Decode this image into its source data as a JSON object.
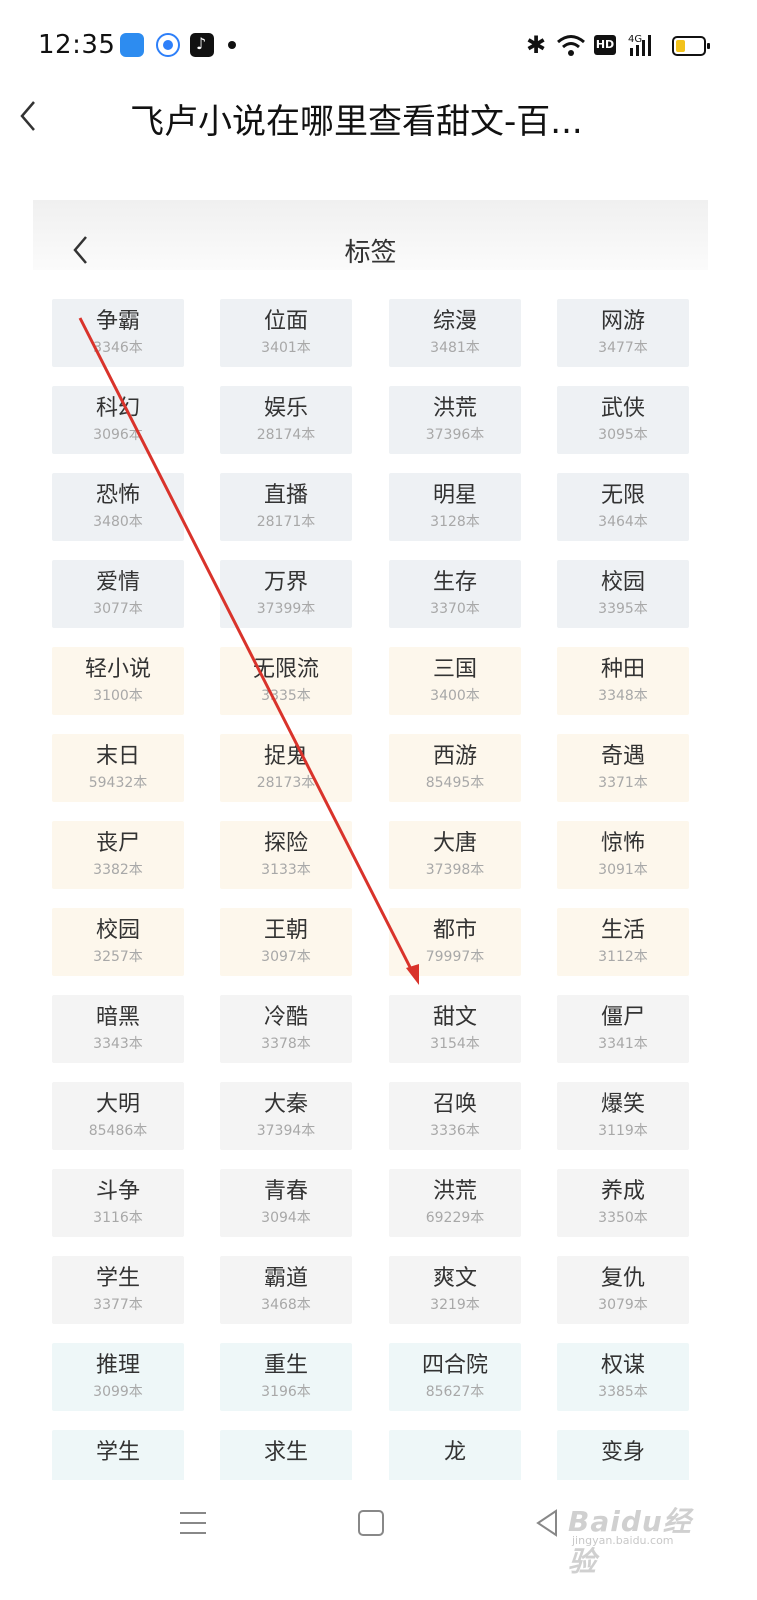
{
  "status_bar": {
    "time": "12:35",
    "icons": [
      "app-blue-icon",
      "qq-browser-icon",
      "tiktok-icon",
      "notification-dot",
      "bluetooth-icon",
      "wifi-icon",
      "hd-icon",
      "signal-4g-icon",
      "battery-icon"
    ],
    "hd_label": "HD",
    "network": "4G"
  },
  "header": {
    "back_icon": "chevron-left-icon",
    "title": "飞卢小说在哪里查看甜文-百..."
  },
  "screenshot": {
    "title": "标签",
    "tags": [
      {
        "name": "争霸",
        "count": "3346本"
      },
      {
        "name": "位面",
        "count": "3401本"
      },
      {
        "name": "综漫",
        "count": "3481本"
      },
      {
        "name": "网游",
        "count": "3477本"
      },
      {
        "name": "科幻",
        "count": "3096本"
      },
      {
        "name": "娱乐",
        "count": "28174本"
      },
      {
        "name": "洪荒",
        "count": "37396本"
      },
      {
        "name": "武侠",
        "count": "3095本"
      },
      {
        "name": "恐怖",
        "count": "3480本"
      },
      {
        "name": "直播",
        "count": "28171本"
      },
      {
        "name": "明星",
        "count": "3128本"
      },
      {
        "name": "无限",
        "count": "3464本"
      },
      {
        "name": "爱情",
        "count": "3077本"
      },
      {
        "name": "万界",
        "count": "37399本"
      },
      {
        "name": "生存",
        "count": "3370本"
      },
      {
        "name": "校园",
        "count": "3395本"
      },
      {
        "name": "轻小说",
        "count": "3100本"
      },
      {
        "name": "无限流",
        "count": "3335本"
      },
      {
        "name": "三国",
        "count": "3400本"
      },
      {
        "name": "种田",
        "count": "3348本"
      },
      {
        "name": "末日",
        "count": "59432本"
      },
      {
        "name": "捉鬼",
        "count": "28173本"
      },
      {
        "name": "西游",
        "count": "85495本"
      },
      {
        "name": "奇遇",
        "count": "3371本"
      },
      {
        "name": "丧尸",
        "count": "3382本"
      },
      {
        "name": "探险",
        "count": "3133本"
      },
      {
        "name": "大唐",
        "count": "37398本"
      },
      {
        "name": "惊怖",
        "count": "3091本"
      },
      {
        "name": "校园",
        "count": "3257本"
      },
      {
        "name": "王朝",
        "count": "3097本"
      },
      {
        "name": "都市",
        "count": "79997本"
      },
      {
        "name": "生活",
        "count": "3112本"
      },
      {
        "name": "暗黑",
        "count": "3343本"
      },
      {
        "name": "冷酷",
        "count": "3378本"
      },
      {
        "name": "甜文",
        "count": "3154本"
      },
      {
        "name": "僵尸",
        "count": "3341本"
      },
      {
        "name": "大明",
        "count": "85486本"
      },
      {
        "name": "大秦",
        "count": "37394本"
      },
      {
        "name": "召唤",
        "count": "3336本"
      },
      {
        "name": "爆笑",
        "count": "3119本"
      },
      {
        "name": "斗争",
        "count": "3116本"
      },
      {
        "name": "青春",
        "count": "3094本"
      },
      {
        "name": "洪荒",
        "count": "69229本"
      },
      {
        "name": "养成",
        "count": "3350本"
      },
      {
        "name": "学生",
        "count": "3377本"
      },
      {
        "name": "霸道",
        "count": "3468本"
      },
      {
        "name": "爽文",
        "count": "3219本"
      },
      {
        "name": "复仇",
        "count": "3079本"
      },
      {
        "name": "推理",
        "count": "3099本"
      },
      {
        "name": "重生",
        "count": "3196本"
      },
      {
        "name": "四合院",
        "count": "85627本"
      },
      {
        "name": "权谋",
        "count": "3385本"
      },
      {
        "name": "学生",
        "count": ""
      },
      {
        "name": "求生",
        "count": ""
      },
      {
        "name": "龙",
        "count": ""
      },
      {
        "name": "变身",
        "count": ""
      }
    ],
    "row_colors": [
      "gray",
      "gray",
      "gray",
      "gray",
      "cream",
      "cream",
      "cream",
      "cream",
      "light",
      "light",
      "light",
      "light",
      "mint",
      "mint"
    ]
  },
  "annotation": {
    "type": "arrow",
    "color": "#d9332b"
  },
  "navbar": {
    "icons": [
      "menu-icon",
      "home-square-icon",
      "back-triangle-icon"
    ]
  },
  "watermark": {
    "brand": "Baidu经验",
    "url": "jingyan.baidu.com"
  }
}
